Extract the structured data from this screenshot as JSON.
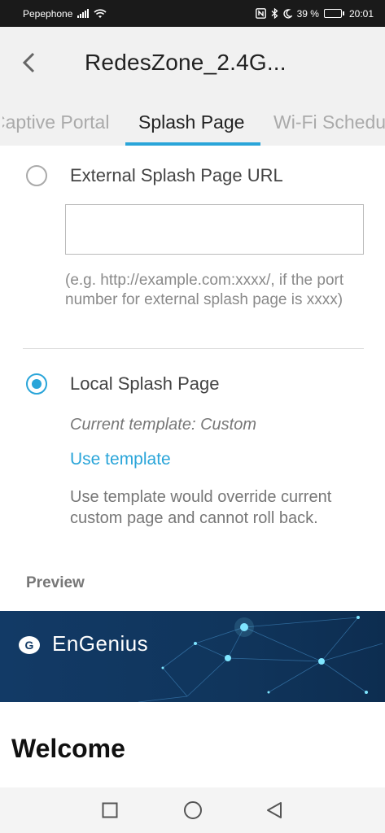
{
  "status_bar": {
    "carrier": "Pepephone",
    "battery": "39 %",
    "battery_level": 0.39,
    "time": "20:01"
  },
  "header": {
    "title": "RedesZone_2.4G..."
  },
  "tabs": [
    {
      "label": "Captive Portal"
    },
    {
      "label": "Splash Page"
    },
    {
      "label": "Wi-Fi Schedule"
    }
  ],
  "active_tab": "Splash Page",
  "options": {
    "external": {
      "label": "External Splash Page URL",
      "url_value": "",
      "hint": "(e.g. http://example.com:xxxx/, if the port number for external splash page is xxxx)"
    },
    "local": {
      "label": "Local Splash Page",
      "current_template": "Current template:  Custom",
      "use_template": "Use template",
      "warning": "Use template would override current custom page and cannot roll back."
    },
    "selected": "local"
  },
  "preview": {
    "label": "Preview",
    "logo_text": "EnGenius",
    "welcome": "Welcome"
  },
  "colors": {
    "accent": "#2aa5d9",
    "banner": "#123a66"
  },
  "icons": [
    "signal-icon",
    "wifi-icon",
    "nfc-icon",
    "bluetooth-icon",
    "moon-icon",
    "battery-icon",
    "back-arrow-icon",
    "square-recents-icon",
    "circle-home-icon",
    "triangle-back-icon"
  ]
}
